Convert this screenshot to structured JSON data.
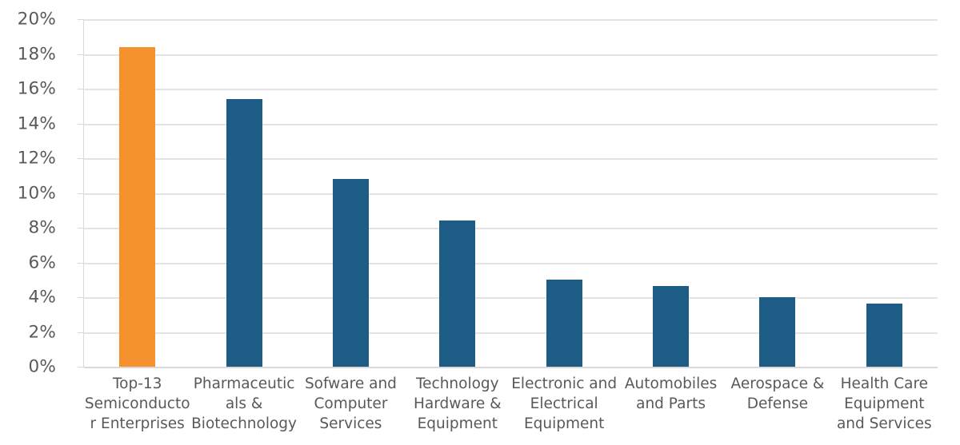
{
  "chart_data": {
    "type": "bar",
    "title": "",
    "subtitle": "",
    "xlabel": "",
    "ylabel": "",
    "ylim": [
      0,
      20
    ],
    "y_tick_labels": [
      "20%",
      "18%",
      "16%",
      "14%",
      "12%",
      "10%",
      "8%",
      "6%",
      "4%",
      "2%",
      "0%"
    ],
    "y_tick_values": [
      20,
      18,
      16,
      14,
      12,
      10,
      8,
      6,
      4,
      2,
      0
    ],
    "y_unit": "%",
    "grid": "horizontal",
    "legend": "none",
    "categories": [
      "Top-13 Semiconductor Enterprises",
      "Pharmaceuticals & Biotechnology",
      "Sofware and Computer Services",
      "Technology Hardware & Equipment",
      "Electronic and Electrical Equipment",
      "Automobiles and Parts",
      "Aerospace & Defense",
      "Health Care Equipment and Services"
    ],
    "values": [
      18.4,
      15.4,
      10.8,
      8.4,
      5.0,
      4.65,
      4.0,
      3.65
    ],
    "bar_colors": [
      "#F5922E",
      "#1D5C85",
      "#1D5C85",
      "#1D5C85",
      "#1D5C85",
      "#1D5C85",
      "#1D5C85",
      "#1D5C85"
    ],
    "colors": {
      "highlight": "#F5922E",
      "series": "#1D5C85",
      "gridline": "#E4E4E4",
      "axis": "#D9D9D9",
      "text": "#595959",
      "background": "#FFFFFF"
    }
  }
}
